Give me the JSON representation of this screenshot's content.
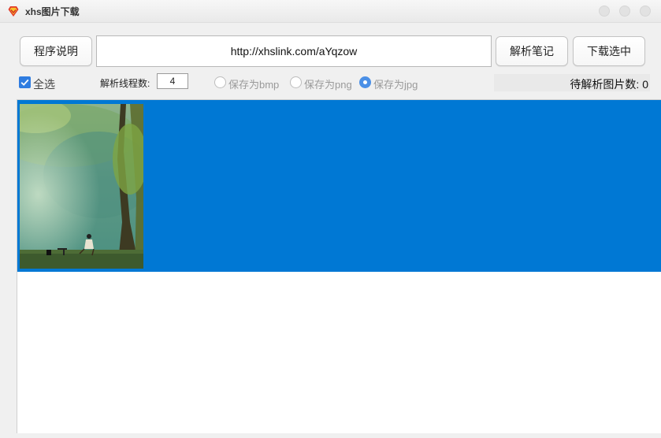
{
  "window": {
    "title": "xhs图片下载",
    "icon": "app-logo-icon"
  },
  "toolbar": {
    "help_label": "程序说明",
    "url_value": "http://xhslink.com/aYqzow",
    "parse_label": "解析笔记",
    "download_label": "下载选中"
  },
  "options": {
    "select_all_label": "全选",
    "select_all_checked": true,
    "threads_label": "解析线程数:",
    "threads_value": "4",
    "formats": [
      {
        "label": "保存为bmp",
        "selected": false
      },
      {
        "label": "保存为png",
        "selected": false
      },
      {
        "label": "保存为jpg",
        "selected": true
      }
    ],
    "pending_label": "待解析图片数:",
    "pending_count": "0"
  },
  "colors": {
    "selection": "#0078d4",
    "checkbox": "#2f7ce0",
    "radio_selected": "#4a8fe6"
  },
  "list": {
    "items": [
      {
        "type": "image-thumbnail",
        "selected": true,
        "scene": "forest hillside, person seated in chair"
      }
    ]
  }
}
